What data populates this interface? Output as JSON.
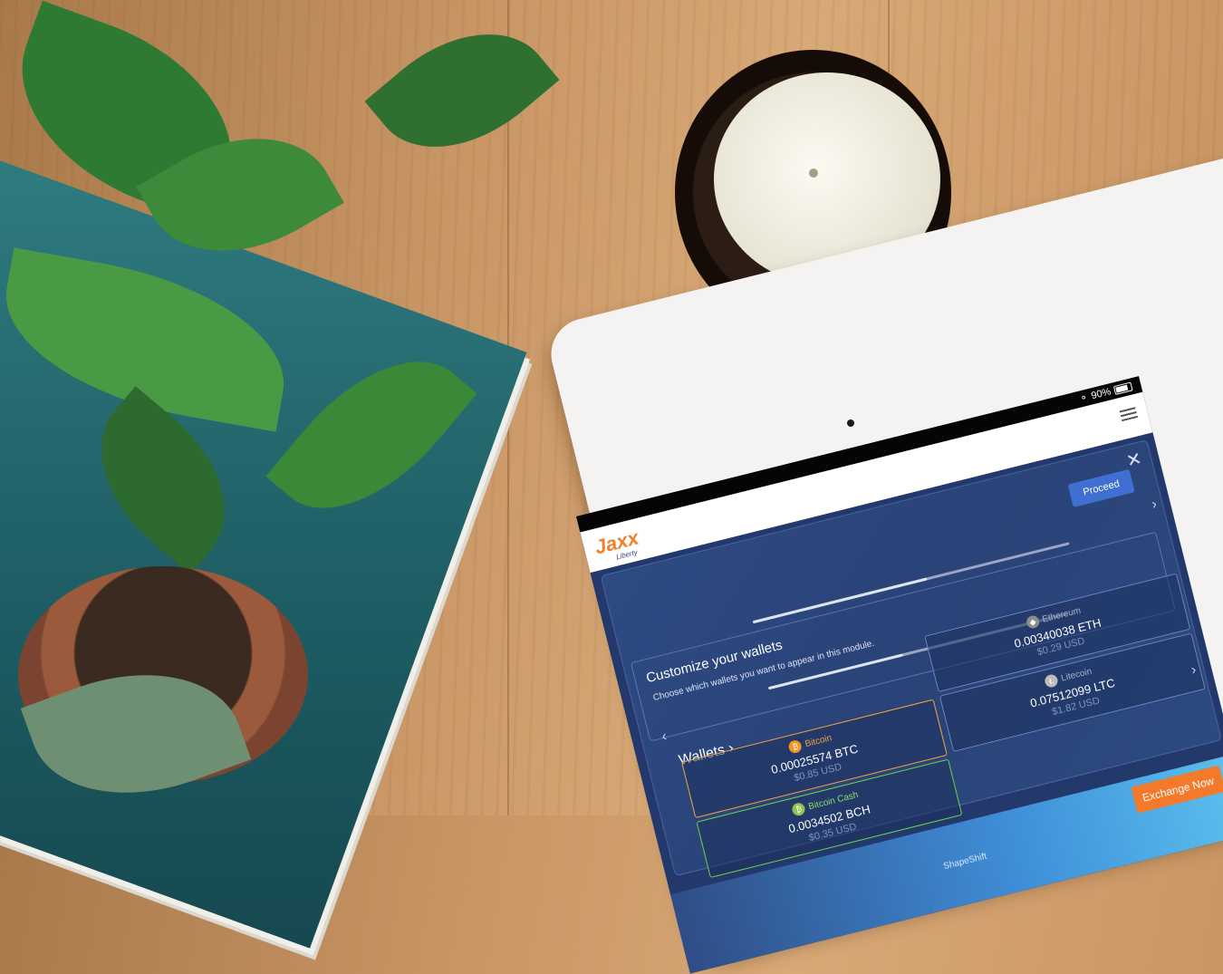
{
  "status_bar": {
    "wifi_icon": "wifi-icon",
    "battery_percent": "90%"
  },
  "app": {
    "logo_text": "Jaxx",
    "logo_sub": "Liberty",
    "menu_icon": "hamburger-icon"
  },
  "modal": {
    "close_icon": "close-icon",
    "proceed_label": "Proceed",
    "title": "Customize your wallets",
    "subtitle": "Choose which wallets you want to appear in this module.",
    "wallets_label": "Wallets",
    "wallets": [
      {
        "name": "Bitcoin",
        "amount": "0.00025574 BTC",
        "usd": "$0.85 USD",
        "icon": "bitcoin-icon",
        "color": "#f7931a",
        "selected": true
      },
      {
        "name": "Ethereum",
        "amount": "0.00340038 ETH",
        "usd": "$0.29 USD",
        "icon": "ethereum-icon",
        "color": "#8c8c8c",
        "selected": false
      },
      {
        "name": "Bitcoin Cash",
        "amount": "0.0034502 BCH",
        "usd": "$0.35 USD",
        "icon": "bitcoin-cash-icon",
        "color": "#8dc351",
        "selected": true
      },
      {
        "name": "Litecoin",
        "amount": "0.07512099 LTC",
        "usd": "$1.82 USD",
        "icon": "litecoin-icon",
        "color": "#bfbbbb",
        "selected": false
      }
    ]
  },
  "footer": {
    "exchange_label": "Exchange Now",
    "shapeshift_text": "ShapeShift"
  }
}
